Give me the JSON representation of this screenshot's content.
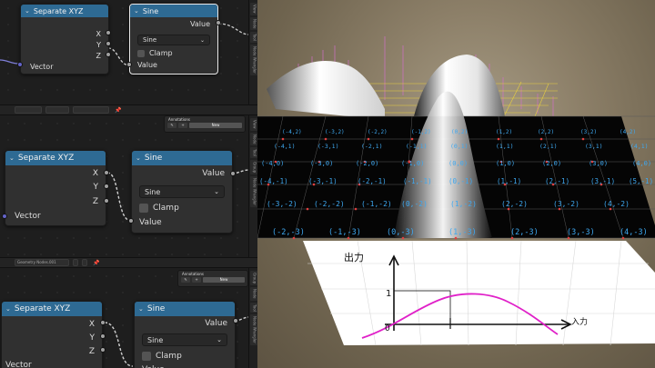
{
  "node_editor": {
    "separate_title": "Separate XYZ",
    "sine_title": "Sine",
    "x_label": "X",
    "y_label": "Y",
    "z_label": "Z",
    "vector_label": "Vector",
    "value_label": "Value",
    "sine_dropdown": "Sine",
    "clamp_label": "Clamp",
    "side_tabs": [
      "View",
      "Node",
      "Tool",
      "Group",
      "Node Wrangler"
    ],
    "annotations_title": "Annotations",
    "new_label": "New",
    "geometry_nodes_label": "Geometry Nodes.001"
  },
  "viewport": {
    "grid_labels": {
      "row_p2": [
        "(-4,2)",
        "(-3,2)",
        "(-2,2)",
        "(-1,2)",
        "(0,2)",
        "(1,2)",
        "(2,2)",
        "(3,2)",
        "(4,2)"
      ],
      "row_p1": [
        "(-4,1)",
        "(-3,1)",
        "(-2,1)",
        "(-1,1)",
        "(0,1)",
        "(1,1)",
        "(2,1)",
        "(3,1)",
        "(4,1)"
      ],
      "row_0": [
        "(-4,0)",
        "(-3,0)",
        "(-2,0)",
        "(-1,0)",
        "(0,0)",
        "(1,0)",
        "(2,0)",
        "(3,0)",
        "(4,0)",
        "(5,0)"
      ],
      "row_m1": [
        "(-4,-1)",
        "(-3,-1)",
        "(-2,-1)",
        "(-1,-1)",
        "(0,-1)",
        "(1,-1)",
        "(2,-1)",
        "(3,-1)",
        "(4,-1)",
        "(5,-1)"
      ],
      "row_m2": [
        "(-3,-2)",
        "(-2,-2)",
        "(-1,-2)",
        "(0,-2)",
        "(1,-2)",
        "(2,-2)",
        "(3,-2)",
        "(4,-2)"
      ],
      "row_m3": [
        "(-2,-3)",
        "(-1,-3)",
        "(0,-3)",
        "(1,-3)",
        "(2,-3)",
        "(3,-3)",
        "(4,-3)"
      ]
    },
    "diagram": {
      "output_label": "出力",
      "input_label": "入力",
      "one_label": "1",
      "zero_label": "0",
      "tick_label": "1",
      "curve_color": "#e020c8"
    }
  }
}
